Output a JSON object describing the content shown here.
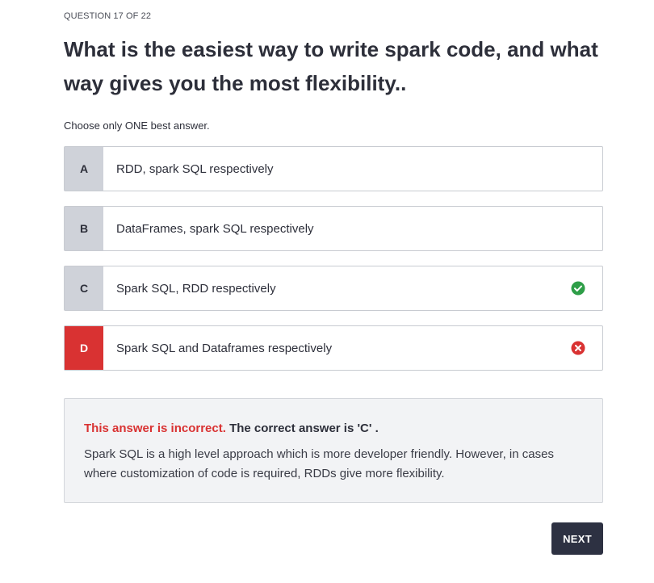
{
  "quiz": {
    "counter": "QUESTION 17 OF 22",
    "question": "What is the easiest way to write spark code, and what way gives you the most flexibility..",
    "instruction": "Choose only ONE best answer.",
    "options": [
      {
        "letter": "A",
        "text": "RDD, spark SQL respectively",
        "status": ""
      },
      {
        "letter": "B",
        "text": "DataFrames, spark SQL respectively",
        "status": ""
      },
      {
        "letter": "C",
        "text": "Spark SQL, RDD respectively",
        "status": "correct",
        "status_icon": "check-circle-icon"
      },
      {
        "letter": "D",
        "text": "Spark SQL and Dataframes respectively",
        "status": "incorrect-selected",
        "status_icon": "x-circle-icon"
      }
    ]
  },
  "feedback": {
    "result_label": "This answer is incorrect.",
    "correct_label": "The correct answer is 'C' .",
    "explanation": "Spark SQL is a high level approach which is more developer friendly. However, in cases where customization of code is required, RDDs give more flexibility."
  },
  "actions": {
    "next_label": "NEXT"
  },
  "colors": {
    "correct": "#2e9e48",
    "incorrect": "#d93232",
    "button_bg": "#2d3142"
  }
}
